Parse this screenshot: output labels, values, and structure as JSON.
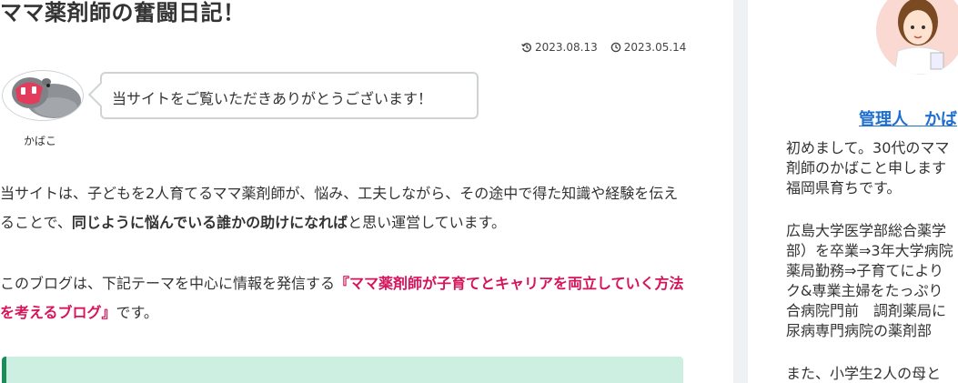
{
  "article": {
    "title": "ママ薬剤師の奮闘日記！",
    "updated_date": "2023.08.13",
    "published_date": "2023.05.14",
    "speech": {
      "avatar_name": "かばこ",
      "text": "当サイトをご覧いただきありがとうございます！"
    },
    "paragraph1": {
      "part1": "当サイトは、子どもを2人育てるママ薬剤師が、悩み、工夫しながら、その途中で得た知識や経験を伝えることで、",
      "bold": "同じように悩んでいる誰かの助けになれば",
      "part2": "と思い運営しています。"
    },
    "paragraph2": {
      "part1": "このブログは、下記テーマを中心に情報を発信する",
      "highlight": "『ママ薬剤師が子育てとキャリアを両立していく方法を考えるブログ』",
      "part2": "です。"
    }
  },
  "sidebar": {
    "admin_name": "管理人　かば",
    "intro": "初めまして。30代のママ\n剤師のかばこと申します\n福岡県育ちです。",
    "career": "広島大学医学部総合薬学\n部）を卒業⇒3年大学病院\n薬局勤務⇒子育てにより\nク&専業主婦をたっぷり\n合病院門前　調剤薬局に\n尿病専門病院の薬剤部",
    "more": "また、小学生2人の母と"
  },
  "colors": {
    "accent": "#d7135a",
    "link": "#1f6fd1",
    "info_box_bg": "#cdefe2",
    "info_box_border": "#1a8d5a"
  }
}
